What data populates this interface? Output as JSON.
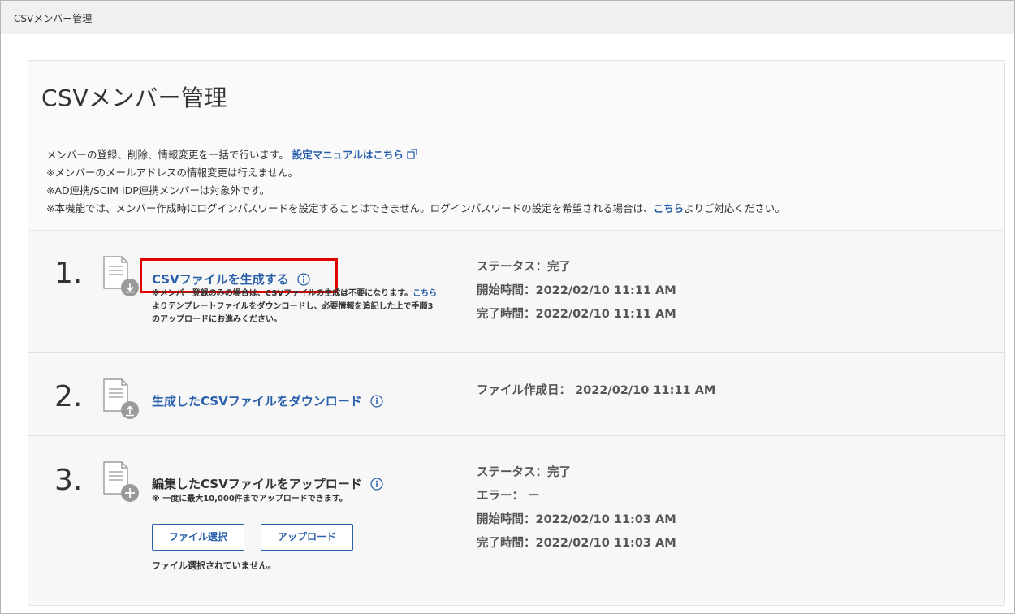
{
  "window": {
    "title": "CSVメンバー管理"
  },
  "page": {
    "heading": "CSVメンバー管理"
  },
  "intro": {
    "line1": "メンバーの登録、削除、情報変更を一括で行います。",
    "manual_link": "設定マニュアルはこちら",
    "line2": "※メンバーのメールアドレスの情報変更は行えません。",
    "line3": "※AD連携/SCIM IDP連携メンバーは対象外です。",
    "line4_pre": "※本機能では、メンバー作成時にログインパスワードを設定することはできません。ログインパスワードの設定を希望される場合は、",
    "line4_link": "こちら",
    "line4_post": "よりご対応ください。"
  },
  "steps": [
    {
      "number": "1.",
      "title": "CSVファイルを生成する",
      "note_line1": "※メンバー登録のみの場合は、CSVファイルの生成は不要になります。",
      "note_link": "こちら",
      "note_line2": "よりテンプレートファイルをダウンロードし、必要情報を追記した上で手順3",
      "note_line3": "のアップロードにお進みください。",
      "status": "ステータス：完了",
      "start": "開始時間：2022/02/10 11:11 AM",
      "end": "完了時間：2022/02/10 11:11 AM",
      "icon": "file-download-icon"
    },
    {
      "number": "2.",
      "title": "生成したCSVファイルをダウンロード",
      "created": "ファイル作成日： 2022/02/10 11:11 AM",
      "icon": "file-upload-icon"
    },
    {
      "number": "3.",
      "title": "編集したCSVファイルをアップロード",
      "note": "※ 一度に最大10,000件までアップロードできます。",
      "select_button": "ファイル選択",
      "upload_button": "アップロード",
      "file_status": "ファイル選択されていません。",
      "status": "ステータス：完了",
      "error": "エラー： ー",
      "start": "開始時間：2022/02/10 11:03 AM",
      "end": "完了時間：2022/02/10 11:03 AM",
      "icon": "file-add-icon"
    }
  ],
  "colors": {
    "link": "#2a5fab",
    "highlight": "#e00000",
    "icon_gray": "#9a9a9a"
  }
}
